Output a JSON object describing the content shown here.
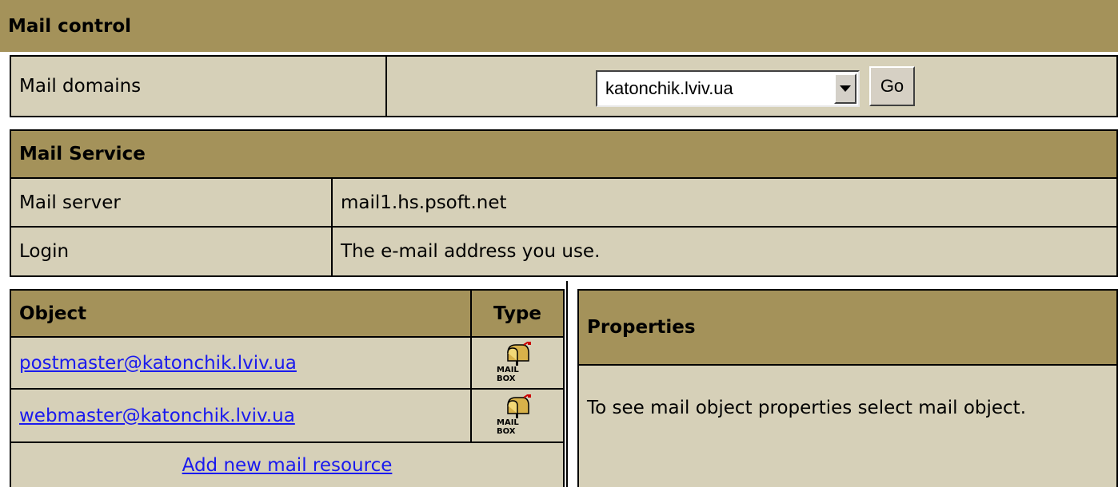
{
  "mail_control": {
    "title": "Mail control",
    "domains_label": "Mail domains",
    "domain_selected": "katonchik.lviv.ua",
    "go_label": "Go"
  },
  "mail_service": {
    "title": "Mail Service",
    "rows": [
      {
        "label": "Mail server",
        "value": "mail1.hs.psoft.net"
      },
      {
        "label": "Login",
        "value": "The e-mail address you use."
      }
    ]
  },
  "objects": {
    "col_object": "Object",
    "col_type": "Type",
    "items": [
      {
        "address": "postmaster@katonchik.lviv.ua",
        "type_icon": "mailbox-icon",
        "type_caption": "MAIL BOX"
      },
      {
        "address": "webmaster@katonchik.lviv.ua",
        "type_icon": "mailbox-icon",
        "type_caption": "MAIL BOX"
      }
    ],
    "add_link": "Add new mail resource"
  },
  "properties": {
    "title": "Properties",
    "message": "To see mail object properties select mail object."
  },
  "colors": {
    "header_bg": "#a4925a",
    "cell_bg": "#d6d0b8",
    "link": "#1a1aee"
  }
}
